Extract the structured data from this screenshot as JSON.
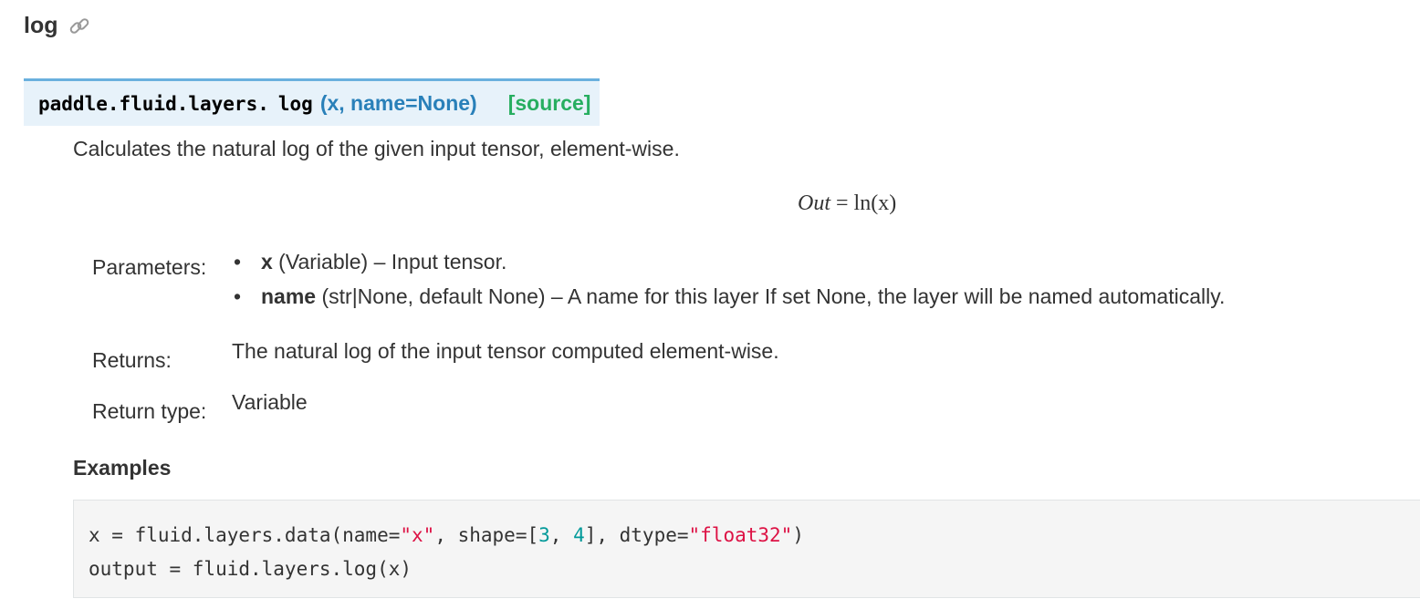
{
  "heading": {
    "text": "log",
    "icon": "link-icon"
  },
  "signature": {
    "prefix": "paddle.fluid.layers.",
    "name": "log",
    "params": "(x, name=None)",
    "source_link": "[source]"
  },
  "description": "Calculates the natural log of the given input tensor, element-wise.",
  "formula": {
    "lhs": "Out",
    "eq": " = ",
    "rhs": "ln(x)"
  },
  "fields": {
    "parameters_label": "Parameters:",
    "parameters": [
      {
        "name": "x",
        "detail": " (Variable) – Input tensor."
      },
      {
        "name": "name",
        "detail": " (str|None, default None) – A name for this layer If set None, the layer will be named automatically."
      }
    ],
    "returns_label": "Returns:",
    "returns_value": "The natural log of the input tensor computed element-wise.",
    "return_type_label": "Return type:",
    "return_type_value": "Variable"
  },
  "examples": {
    "title": "Examples",
    "code": [
      [
        {
          "t": "plain",
          "v": "x = fluid.layers.data(name="
        },
        {
          "t": "str",
          "v": "\"x\""
        },
        {
          "t": "plain",
          "v": ", shape=["
        },
        {
          "t": "num",
          "v": "3"
        },
        {
          "t": "plain",
          "v": ", "
        },
        {
          "t": "num",
          "v": "4"
        },
        {
          "t": "plain",
          "v": "], dtype="
        },
        {
          "t": "str",
          "v": "\"float32\""
        },
        {
          "t": "plain",
          "v": ")"
        }
      ],
      [
        {
          "t": "plain",
          "v": "output = fluid.layers.log(x)"
        }
      ]
    ]
  },
  "colors": {
    "signature_bg": "#e7f2fa",
    "signature_border": "#6ab0de",
    "params_blue": "#2980b9",
    "source_green": "#27ae60",
    "code_string": "#dd1144",
    "code_number": "#009999",
    "code_bg": "#f5f5f5"
  }
}
